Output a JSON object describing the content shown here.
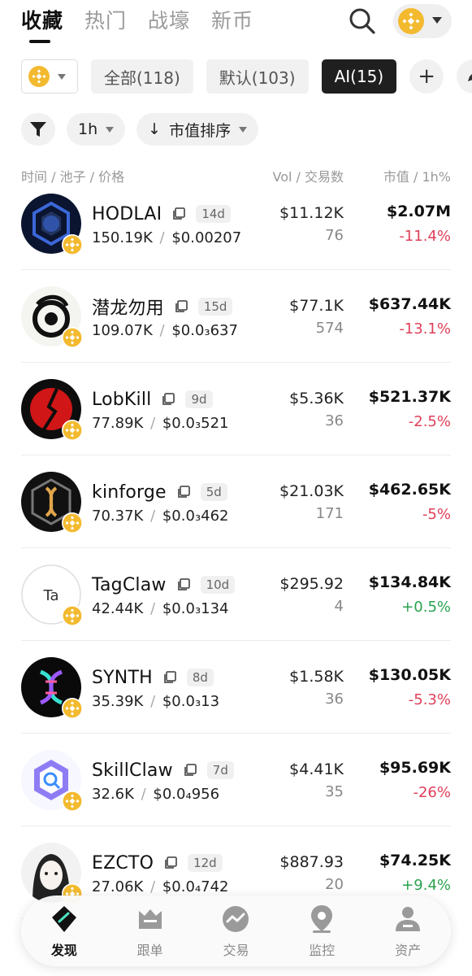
{
  "header": {
    "tabs": [
      {
        "label": "收藏",
        "active": true
      },
      {
        "label": "热门",
        "active": false
      },
      {
        "label": "战壕",
        "active": false
      },
      {
        "label": "新币",
        "active": false
      }
    ],
    "search_icon": "search-icon",
    "chain_icon": "bnb-icon"
  },
  "chips": [
    {
      "label": "全部(118)",
      "active": false
    },
    {
      "label": "默认(103)",
      "active": false
    },
    {
      "label": "AI(15)",
      "active": true
    }
  ],
  "add_label": "+",
  "filters": {
    "filter_icon": "filter-icon",
    "interval": "1h",
    "sort_arrow": "↓",
    "sort_label": "市值排序"
  },
  "columns": {
    "left": "时间 / 池子 / 价格",
    "middle": "Vol / 交易数",
    "right": "市值 / 1h%"
  },
  "tokens": [
    {
      "name": "HODLAI",
      "age": "14d",
      "pool": "150.19K",
      "price": "$0.00207",
      "vol": "$11.12K",
      "tx": "76",
      "mcap": "$2.07M",
      "change": "-11.4%",
      "dir": "down"
    },
    {
      "name": "潜龙勿用",
      "age": "15d",
      "pool": "109.07K",
      "price": "$0.0₃637",
      "vol": "$77.1K",
      "tx": "574",
      "mcap": "$637.44K",
      "change": "-13.1%",
      "dir": "down"
    },
    {
      "name": "LobKill",
      "age": "9d",
      "pool": "77.89K",
      "price": "$0.0₃521",
      "vol": "$5.36K",
      "tx": "36",
      "mcap": "$521.37K",
      "change": "-2.5%",
      "dir": "down"
    },
    {
      "name": "kinforge",
      "age": "5d",
      "pool": "70.37K",
      "price": "$0.0₃462",
      "vol": "$21.03K",
      "tx": "171",
      "mcap": "$462.65K",
      "change": "-5%",
      "dir": "down"
    },
    {
      "name": "TagClaw",
      "age": "10d",
      "pool": "42.44K",
      "price": "$0.0₃134",
      "vol": "$295.92",
      "tx": "4",
      "mcap": "$134.84K",
      "change": "+0.5%",
      "dir": "up",
      "avatar_text": "Ta"
    },
    {
      "name": "SYNTH",
      "age": "8d",
      "pool": "35.39K",
      "price": "$0.0₃13",
      "vol": "$1.58K",
      "tx": "36",
      "mcap": "$130.05K",
      "change": "-5.3%",
      "dir": "down"
    },
    {
      "name": "SkillClaw",
      "age": "7d",
      "pool": "32.6K",
      "price": "$0.0₄956",
      "vol": "$4.41K",
      "tx": "35",
      "mcap": "$95.69K",
      "change": "-26%",
      "dir": "down"
    },
    {
      "name": "EZCTO",
      "age": "12d",
      "pool": "27.06K",
      "price": "$0.0₄742",
      "vol": "$887.93",
      "tx": "20",
      "mcap": "$74.25K",
      "change": "+9.4%",
      "dir": "up"
    }
  ],
  "nav": [
    {
      "label": "发现",
      "icon": "discover-icon",
      "active": true
    },
    {
      "label": "跟单",
      "icon": "copy-trade-icon",
      "active": false
    },
    {
      "label": "交易",
      "icon": "trade-icon",
      "active": false
    },
    {
      "label": "监控",
      "icon": "monitor-icon",
      "active": false
    },
    {
      "label": "资产",
      "icon": "assets-icon",
      "active": false
    }
  ],
  "colors": {
    "bnb": "#F3BA2F",
    "down": "#e0405a",
    "up": "#2aa34f",
    "active_chip": "#1f1f1f"
  }
}
